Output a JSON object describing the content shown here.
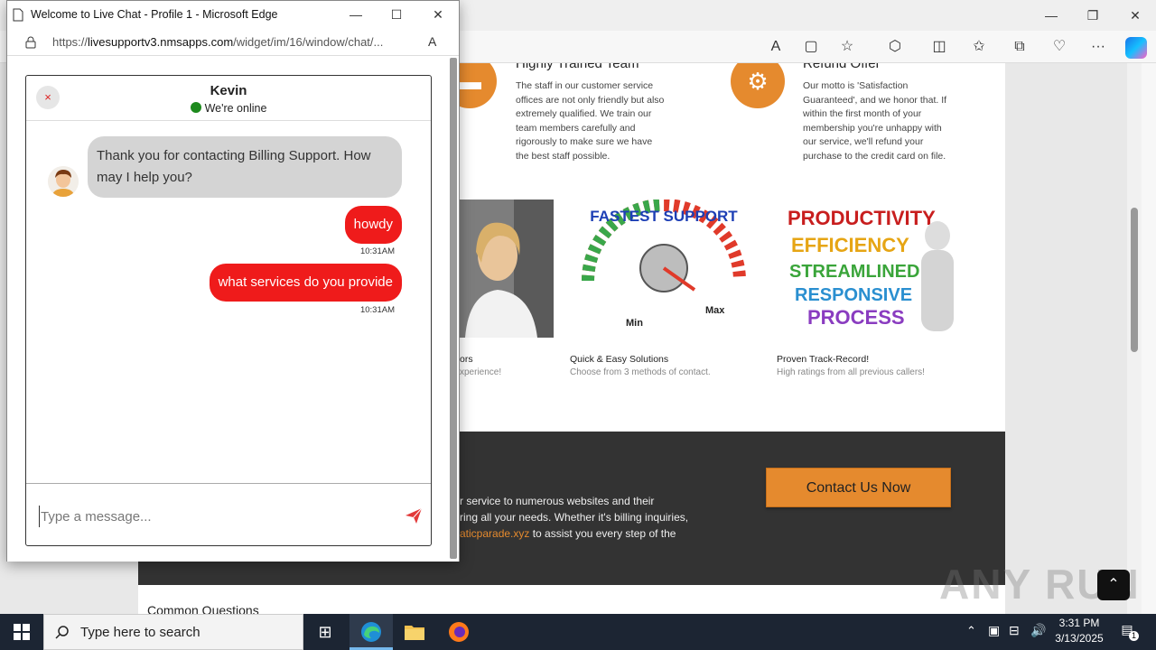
{
  "popup": {
    "title": "Welcome to Live Chat - Profile 1 - Microsoft Edge",
    "url_prefix": "https://",
    "url_host": "livesupportv3.nmsapps.com",
    "url_path": "/widget/im/16/window/chat/..."
  },
  "chat": {
    "agent_name": "Kevin",
    "status": "We're online",
    "status_color": "#1d8a1d",
    "messages": [
      {
        "from": "agent",
        "text": "Thank you for contacting Billing Support. How may I help you?"
      },
      {
        "from": "user",
        "text": "howdy",
        "time": "10:31AM"
      },
      {
        "from": "user",
        "text": "what services do you provide",
        "time": "10:31AM"
      }
    ],
    "input_placeholder": "Type a message...",
    "close_label": "×",
    "user_bubble_color": "#ef1b1b"
  },
  "site": {
    "features": [
      {
        "title": "Highly Trained Team",
        "text": "The staff in our customer service offices are not only friendly but also extremely qualified. We train our team members carefully and rigorously to make sure we have the best staff possible."
      },
      {
        "title": "Refund Offer",
        "text": "Our motto is 'Satisfaction Guaranteed', and we honor that. If within the first month of your membership you're unhappy with our service, we'll refund your purchase to the credit card on file."
      }
    ],
    "captions": [
      {
        "title": "ors",
        "sub": "xperience!"
      },
      {
        "title": "Quick & Easy Solutions",
        "sub": "Choose from 3 methods of contact."
      },
      {
        "title": "Proven Track-Record!",
        "sub": "High ratings from all previous callers!"
      }
    ],
    "gauge": {
      "title": "FASTEST SUPPORT",
      "min": "Min",
      "max": "Max"
    },
    "words_image": [
      "PRODUCTIVITY",
      "EFFICIENCY",
      "STREAMLINED",
      "RESPONSIVE",
      "PROCESS"
    ],
    "dark_lines": [
      "r service to numerous websites and their",
      "ring all your needs. Whether it's billing inquiries,",
      "to assist you every step of the"
    ],
    "dark_link": "aticparade.xyz",
    "contact_button": "Contact Us Now",
    "below_text": "Common Questions",
    "accent_color": "#e58a2e"
  },
  "watermark": "ANY RUN",
  "taskbar": {
    "search_placeholder": "Type here to search",
    "time": "3:31 PM",
    "date": "3/13/2025",
    "notif_count": "1"
  }
}
